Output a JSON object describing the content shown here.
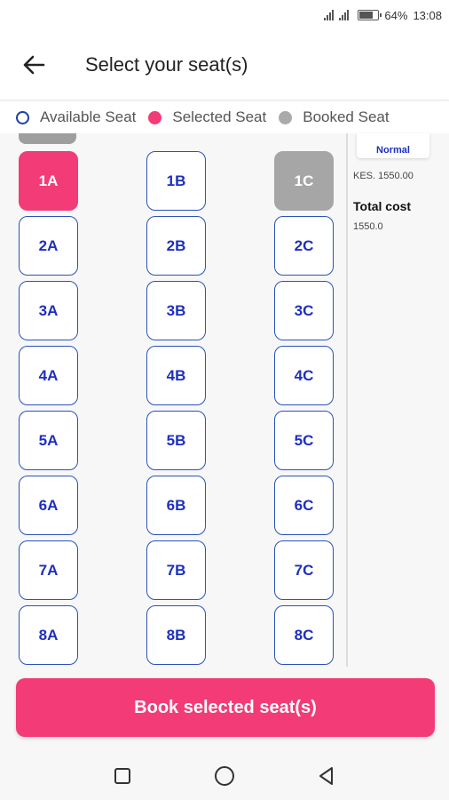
{
  "status_bar": {
    "battery": "64%",
    "time": "13:08"
  },
  "header": {
    "title": "Select your seat(s)"
  },
  "legend": {
    "available": "Available Seat",
    "selected": "Selected Seat",
    "booked": "Booked Seat"
  },
  "seats": [
    [
      {
        "label": "1A",
        "state": "selected"
      },
      {
        "label": "1B",
        "state": "available"
      },
      {
        "label": "1C",
        "state": "booked"
      }
    ],
    [
      {
        "label": "2A",
        "state": "available"
      },
      {
        "label": "2B",
        "state": "available"
      },
      {
        "label": "2C",
        "state": "available"
      }
    ],
    [
      {
        "label": "3A",
        "state": "available"
      },
      {
        "label": "3B",
        "state": "available"
      },
      {
        "label": "3C",
        "state": "available"
      }
    ],
    [
      {
        "label": "4A",
        "state": "available"
      },
      {
        "label": "4B",
        "state": "available"
      },
      {
        "label": "4C",
        "state": "available"
      }
    ],
    [
      {
        "label": "5A",
        "state": "available"
      },
      {
        "label": "5B",
        "state": "available"
      },
      {
        "label": "5C",
        "state": "available"
      }
    ],
    [
      {
        "label": "6A",
        "state": "available"
      },
      {
        "label": "6B",
        "state": "available"
      },
      {
        "label": "6C",
        "state": "available"
      }
    ],
    [
      {
        "label": "7A",
        "state": "available"
      },
      {
        "label": "7B",
        "state": "available"
      },
      {
        "label": "7C",
        "state": "available"
      }
    ],
    [
      {
        "label": "8A",
        "state": "available"
      },
      {
        "label": "8B",
        "state": "available"
      },
      {
        "label": "8C",
        "state": "available"
      }
    ]
  ],
  "summary": {
    "ticket_class": "Normal",
    "price": "KES. 1550.00",
    "total_label": "Total cost",
    "total_value": "1550.0"
  },
  "book_button": "Book selected seat(s)",
  "colors": {
    "accent": "#f23b77",
    "seat_border": "#2a52b8",
    "seat_text": "#1d2fbf",
    "booked": "#a6a6a6"
  }
}
